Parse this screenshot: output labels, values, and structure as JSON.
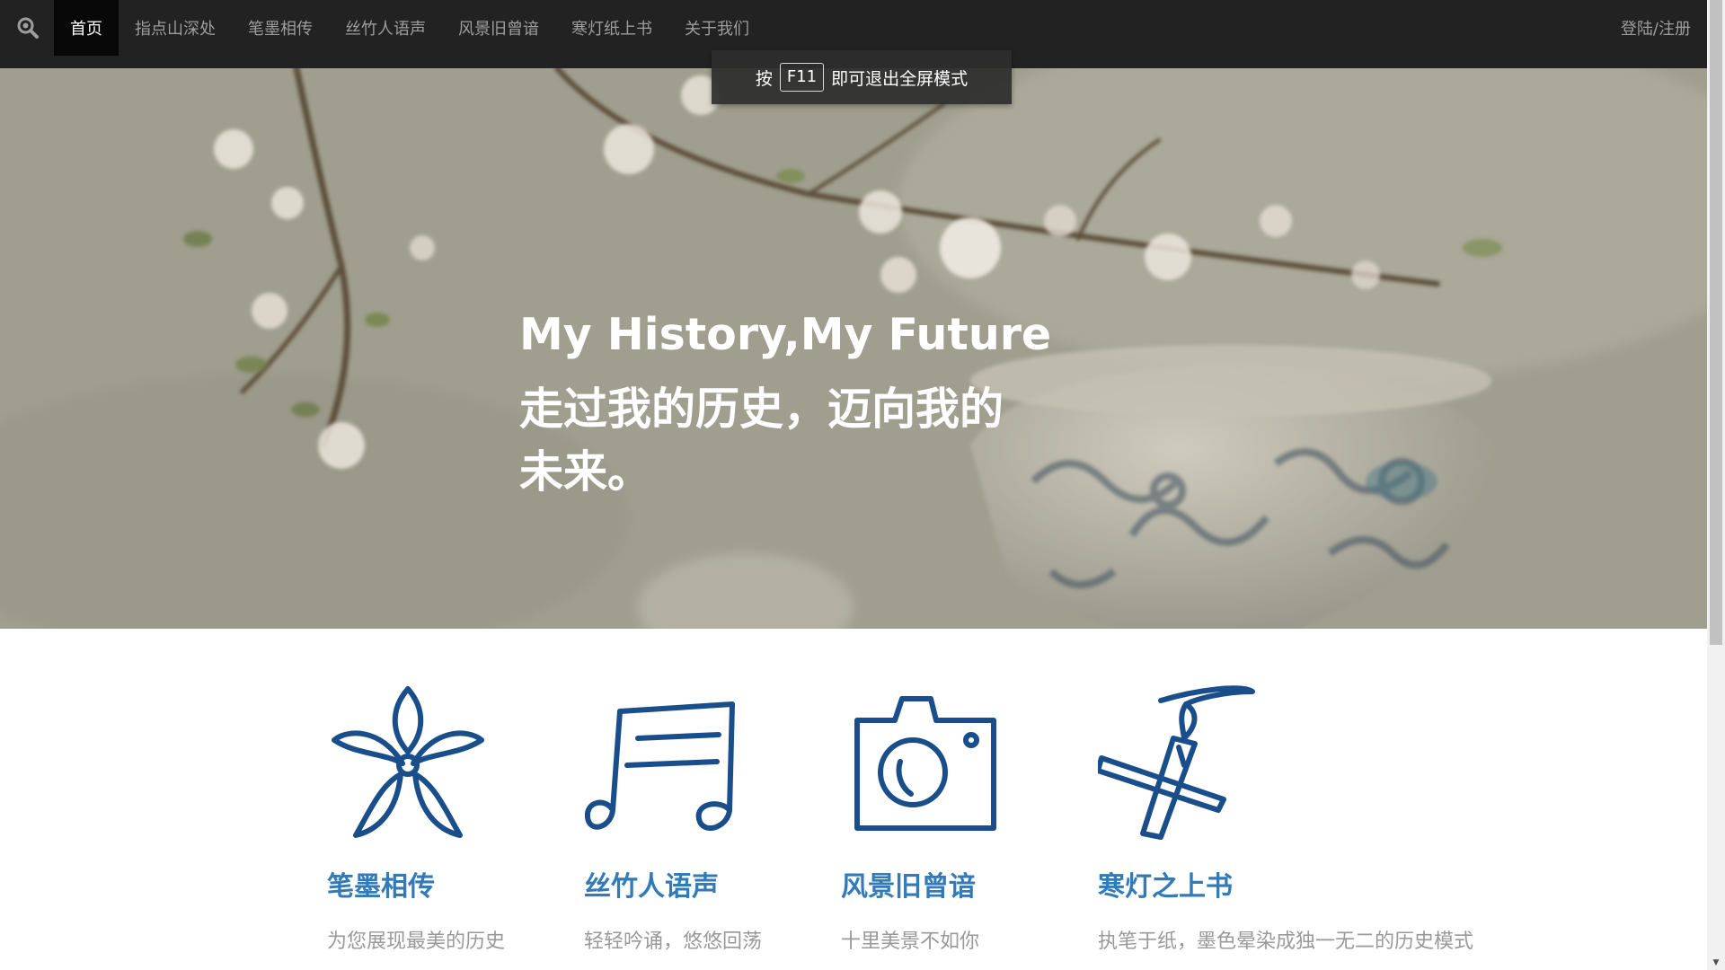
{
  "nav": {
    "search_icon": "search-icon",
    "items": [
      {
        "label": "首页",
        "active": true
      },
      {
        "label": "指点山深处"
      },
      {
        "label": "笔墨相传"
      },
      {
        "label": "丝竹人语声"
      },
      {
        "label": "风景旧曾谙"
      },
      {
        "label": "寒灯纸上书"
      },
      {
        "label": "关于我们"
      }
    ],
    "login": "登陆/注册"
  },
  "toast": {
    "prefix": "按",
    "key": "F11",
    "suffix": "即可退出全屏模式"
  },
  "hero": {
    "title": "My History,My Future",
    "subtitle": "走过我的历史，迈向我的未来。"
  },
  "features": [
    {
      "icon": "flower-icon",
      "title": "笔墨相传",
      "desc": "为您展现最美的历史"
    },
    {
      "icon": "music-note-icon",
      "title": "丝竹人语声",
      "desc": "轻轻吟诵，悠悠回荡"
    },
    {
      "icon": "camera-icon",
      "title": "风景旧曾谙",
      "desc": "十里美景不如你"
    },
    {
      "icon": "brush-pen-icon",
      "title": "寒灯之上书",
      "desc": "执笔于纸，墨色晕染成独一无二的历史模式"
    }
  ],
  "colors": {
    "navbar": "#222222",
    "nav_active": "#080808",
    "accent": "#337ab7",
    "icon_stroke": "#1a4e8a",
    "desc_text": "#999999"
  }
}
